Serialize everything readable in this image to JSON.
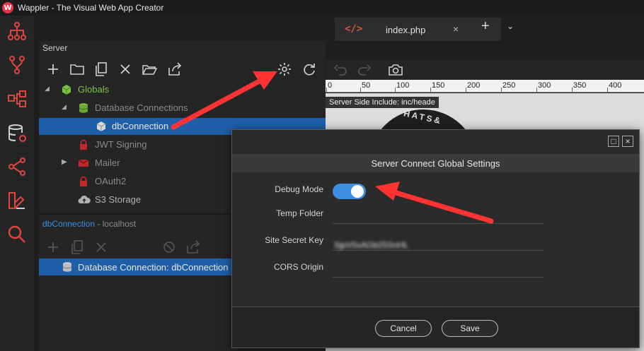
{
  "window": {
    "title": "Wappler - The Visual Web App Creator",
    "logo_letter": "W"
  },
  "sidebar_icons": [
    "app-structure-icon",
    "git-icon",
    "workflow-icon",
    "database-icon",
    "api-share-icon",
    "design-icon",
    "search-icon"
  ],
  "tabbar": {
    "tab_label": "index.php",
    "tab_code_glyph": "</>",
    "close_glyph": "×",
    "add_glyph": "+",
    "more_glyph": "⌄"
  },
  "server_panel": {
    "header": "Server",
    "tree": [
      {
        "label": "Globals",
        "icon": "cube-icon",
        "color": "#7cc242"
      },
      {
        "label": "Database Connections",
        "icon": "database-icon",
        "color": "#8a8a8a"
      },
      {
        "label": "dbConnection",
        "icon": "cube-icon",
        "color": "#e6e6e6"
      },
      {
        "label": "JWT Signing",
        "icon": "lock-icon",
        "color": "#8a8a8a"
      },
      {
        "label": "Mailer",
        "icon": "mail-icon",
        "color": "#8a8a8a"
      },
      {
        "label": "OAuth2",
        "icon": "lock-icon",
        "color": "#8a8a8a"
      },
      {
        "label": "S3 Storage",
        "icon": "cloud-upload-icon",
        "color": "#b0b0b0"
      }
    ]
  },
  "connection_panel": {
    "title": "dbConnection",
    "subtitle": " - localhost",
    "row_label": "Database Connection: dbConnection"
  },
  "preview": {
    "ruler_ticks": [
      "0",
      "50",
      "100",
      "150",
      "200",
      "250",
      "300",
      "350",
      "400"
    ],
    "ssi_label": "Server Side Include: inc/heade",
    "logo_fragment": "HATS&"
  },
  "dialog": {
    "title": "Server Connect Global Settings",
    "fields": {
      "debug_mode": {
        "label": "Debug Mode",
        "enabled": true
      },
      "temp_folder": {
        "label": "Temp Folder",
        "value": ""
      },
      "site_secret_key": {
        "label": "Site Secret Key",
        "value": "SjpV5xAGb25SnHL"
      },
      "cors_origin": {
        "label": "CORS Origin",
        "value": ""
      }
    },
    "cancel_label": "Cancel",
    "save_label": "Save"
  },
  "colors": {
    "accent": "#3d8de0",
    "selection": "#1e5fa8",
    "arrow": "#ff3333"
  }
}
